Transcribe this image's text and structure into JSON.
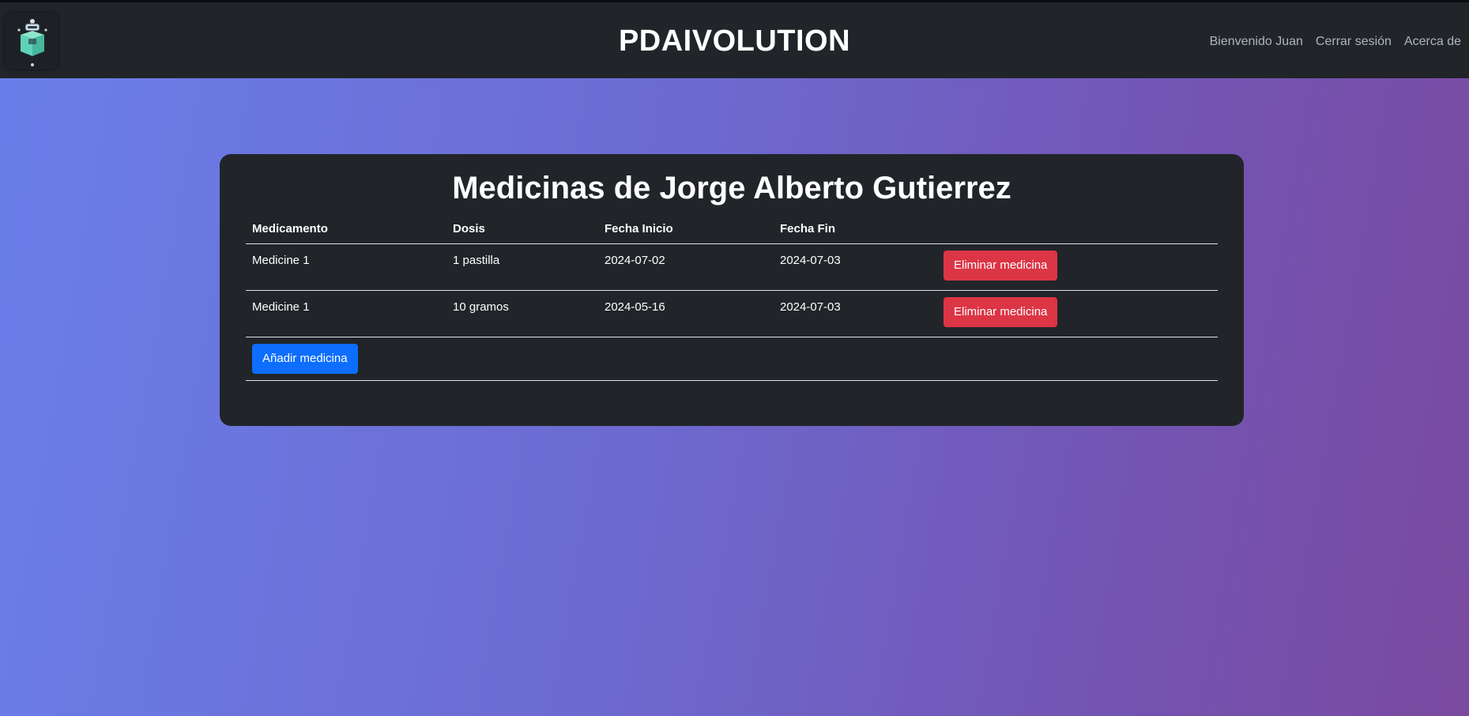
{
  "navbar": {
    "brand": "PDAIVOLUTION",
    "links": [
      {
        "label": "Bienvenido Juan"
      },
      {
        "label": "Cerrar sesión"
      },
      {
        "label": "Acerca de"
      }
    ],
    "logo_icon": "robot-logo-icon"
  },
  "main": {
    "title": "Medicinas de Jorge Alberto Gutierrez",
    "table": {
      "headers": [
        "Medicamento",
        "Dosis",
        "Fecha Inicio",
        "Fecha Fin",
        ""
      ],
      "rows": [
        {
          "medicamento": "Medicine 1",
          "dosis": "1 pastilla",
          "fecha_inicio": "2024-07-02",
          "fecha_fin": "2024-07-03",
          "action_label": "Eliminar medicina"
        },
        {
          "medicamento": "Medicine 1",
          "dosis": "10 gramos",
          "fecha_inicio": "2024-05-16",
          "fecha_fin": "2024-07-03",
          "action_label": "Eliminar medicina"
        }
      ],
      "add_label": "Añadir medicina"
    }
  },
  "colors": {
    "navbar_bg": "#212529",
    "danger": "#dc3545",
    "primary": "#0d6efd",
    "logo_accent": "#5fd3b8"
  }
}
